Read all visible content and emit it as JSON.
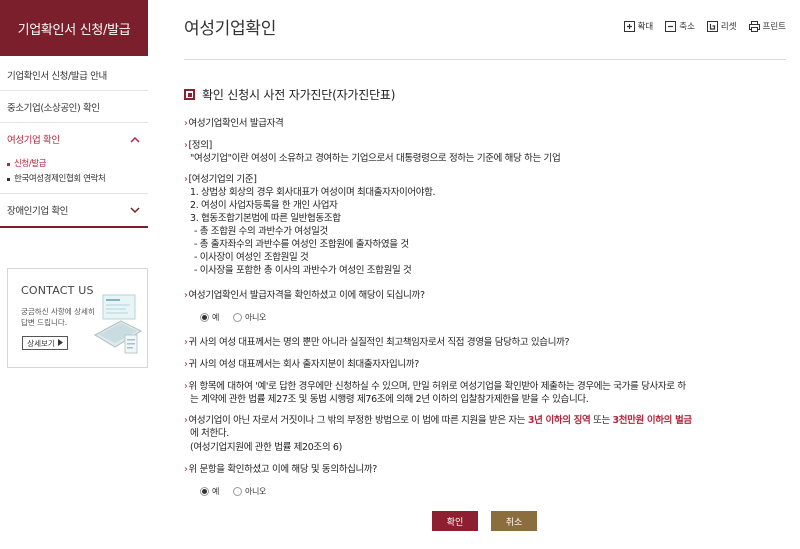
{
  "sidebar": {
    "header": "기업확인서 신청/발급",
    "items": [
      {
        "label": "기업확인서 신청/발급 안내"
      },
      {
        "label": "중소기업(소상공인) 확인"
      },
      {
        "label": "여성기업 확인"
      }
    ],
    "subitems": [
      {
        "label": "신청/발급"
      },
      {
        "label": "한국여성경제인협회 연락처"
      }
    ],
    "last_item": "장애인기업 확인",
    "contact": {
      "title": "CONTACT US",
      "desc": "궁금하신 사항에 상세히 답변 드립니다.",
      "button": "상세보기"
    }
  },
  "header": {
    "title": "여성기업확인",
    "tools": [
      {
        "label": "확대",
        "icon": "zoom-in-icon"
      },
      {
        "label": "축소",
        "icon": "zoom-out-icon"
      },
      {
        "label": "리셋",
        "icon": "reset-icon"
      },
      {
        "label": "프린트",
        "icon": "print-icon"
      }
    ]
  },
  "main": {
    "section_title": "확인 신청시 사전 자가진단(자가진단표)",
    "q1": "여성기업확인서 발급자격",
    "def_head": "[정의]",
    "def_body": "\"여성기업\"이란 여성이 소유하고 경여하는 기업으로서 대통령령으로 정하는 기준에 해당 하는 기업",
    "crit_head": "[여성기업의 기준]",
    "crit": [
      "1. 상법상 회상의 경우 회사대표가 여성이며 최대출자자이어야함.",
      "2. 여성이 사업자등록을 한 개인 사업자",
      "3. 협동조합기본법에 따른 일반협동조합",
      "- 총 조합원 수의 과반수가 여성일것",
      "- 총 출자좌수의 과반수를 여성인 조합원에 출자하였을 것",
      "- 이사장이 여성인 조합원일 것",
      "- 이사장을 포함한 총 이사의 과반수가 여성인 조합원일 것"
    ],
    "q2": "여성기업확인서 발급자격을 확인하셨고 이에 해당이 되십니까?",
    "yes": "예",
    "no": "아니오",
    "q3": "귀 사의 여성 대표께서는 명의 뿐만 아니라 실질적인 최고책임자로서 직접 경영을 담당하고 있습니까?",
    "q4": "귀 사의 여성 대표께서는 회사 출자지분이 최대출자자입니까?",
    "q5_l1": "위 항목에 대하여 '예'로 답한 경우에만 신청하실 수 있으며, 만일 허위로 여성기업을 확인받아 제출하는 경우에는 국가를 당사자로 하",
    "q5_l2": "는 계약에 관한 법률 제27조 및 동법 시행령 제76조에 의해 2년 이하의 입찰참가제한을 받을 수 있습니다.",
    "q6_pre": "여성기업이 아닌 자로서 거짓이나 그 밖의 부정한 방법으로 이 법에 따른 지원을 받은 자는",
    "q6_red1": "3년 이하의 징역",
    "q6_mid": "또는",
    "q6_red2": "3천만원 이하의 벌금",
    "q6_l2": "에 처한다.",
    "q6_l3": "(여성기업지원에 관한 법률 제20조의 6)",
    "q7": "위 문항을 확인하셨고 이에 해당 및 동의하십니까?",
    "ok": "확인",
    "cancel": "취소"
  },
  "colors": {
    "brand": "#7a1f2b",
    "accent_red": "#b0283d",
    "cancel_button": "#8c6d3d"
  }
}
